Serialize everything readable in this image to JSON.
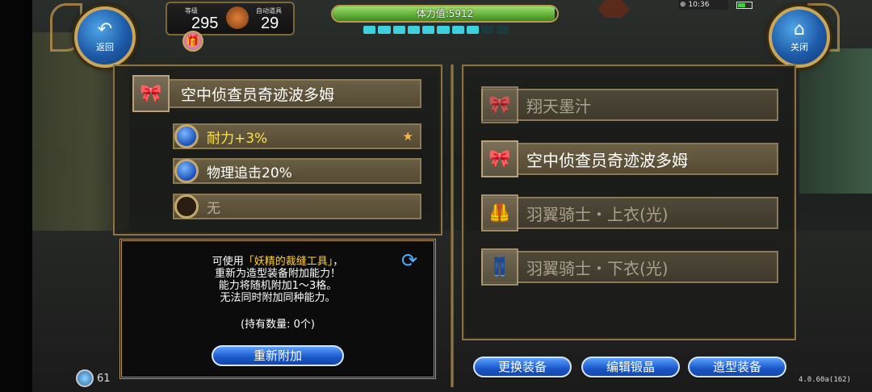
{
  "hud": {
    "level_label": "等级",
    "level_value": "295",
    "auto_food_label": "自动道具",
    "auto_food_value": "29",
    "stamina_text": "体力值:5912",
    "stamina_fraction": 0.99,
    "clock": "10:36"
  },
  "nav": {
    "back_label": "返回",
    "close_label": "关闭"
  },
  "left": {
    "item_name": "空中侦查员奇迹波多姆",
    "stats": [
      {
        "text": "耐力+3%",
        "state": "active"
      },
      {
        "text": "物理追击20%",
        "state": "normal"
      },
      {
        "text": "无",
        "state": "none"
      }
    ]
  },
  "info": {
    "line1_prefix": "可使用",
    "line1_highlight": "「妖精的裁缝工具」",
    "line1_suffix": "，",
    "line2": "重新为造型装备附加能力！",
    "line3": "能力将随机附加1～3格。",
    "line4": "无法同时附加同种能力。",
    "count": "(持有数量: 0个)",
    "readd_button": "重新附加"
  },
  "right": {
    "items": [
      {
        "name": "翔天墨汁",
        "dim": true
      },
      {
        "name": "空中侦查员奇迹波多姆",
        "dim": false
      },
      {
        "name": "羽翼骑士・上衣(光)",
        "dim": true
      },
      {
        "name": "羽翼骑士・下衣(光)",
        "dim": true
      }
    ]
  },
  "buttons": {
    "change": "更换装备",
    "edit": "编辑锻晶",
    "model": "造型装备"
  },
  "footer": {
    "bottom_left": "61",
    "version": "4.0.60a(162)"
  },
  "colors": {
    "gold_border": "#b89a55",
    "highlight_yellow": "#ffe04a",
    "button_blue": "#1a56c8"
  }
}
